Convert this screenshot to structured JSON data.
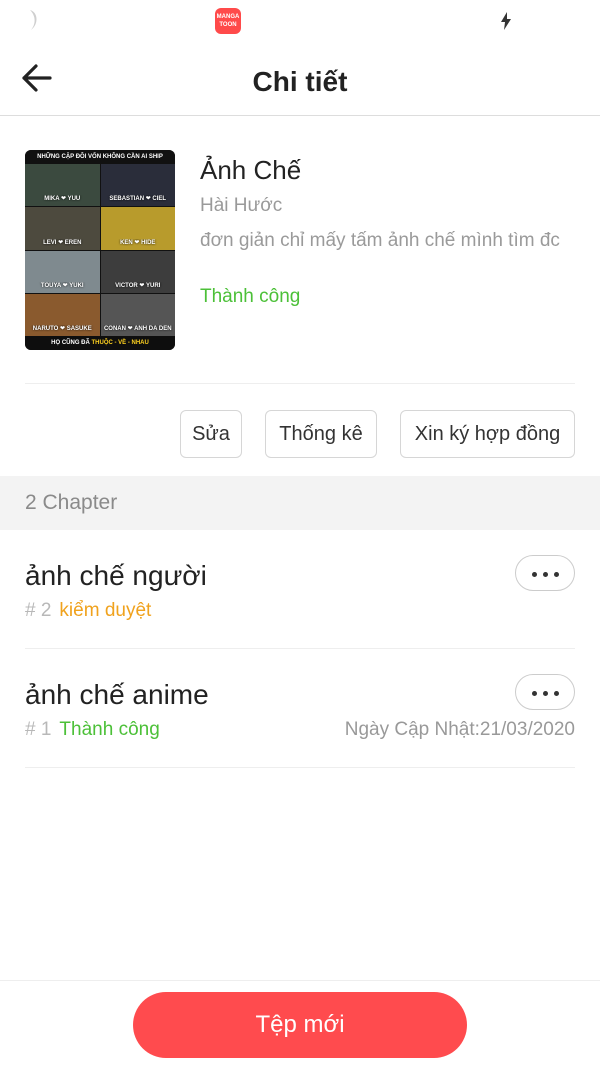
{
  "status_bar": {
    "app_badge": "MANGA TOON",
    "left_icon": "moon-icon",
    "right_icon": "bolt-icon"
  },
  "header": {
    "title": "Chi tiết",
    "back_icon": "arrow-left-icon"
  },
  "comic": {
    "title": "Ảnh Chế",
    "genre": "Hài Hước",
    "description": "đơn giản chỉ mấy tấm ảnh chế mình tìm đc",
    "status": "Thành công",
    "cover": {
      "top_text": "NHỮNG CẶP ĐÔI VỐN KHÔNG CẦN AI SHIP",
      "pairs": [
        "MIKA ❤ YUU",
        "SEBASTIAN ❤ CIEL",
        "LEVI ❤ EREN",
        "KEN ❤ HIDE",
        "TOUYA ❤ YUKI",
        "VICTOR ❤ YURI",
        "NARUTO ❤ SASUKE",
        "CONAN ❤ ANH DA DEN"
      ],
      "bottom_text_prefix": "HỌ CŨNG ĐÃ ",
      "bottom_text_highlight": "THUỘC - VỀ - NHAU"
    }
  },
  "actions": {
    "edit": "Sửa",
    "stats": "Thống kê",
    "contract": "Xin ký hợp đồng"
  },
  "chapters": {
    "count_label": "2 Chapter",
    "items": [
      {
        "title": "ảnh chế người",
        "number": "# 2",
        "status": "kiểm duyệt",
        "date": ""
      },
      {
        "title": "ảnh chế anime",
        "number": "# 1",
        "status": "Thành công",
        "date": "Ngày Cập Nhật:21/03/2020"
      }
    ]
  },
  "footer": {
    "new_button": "Tệp mới"
  },
  "colors": {
    "accent": "#ff4b4e",
    "success": "#4cc038",
    "pending": "#f0a21d"
  }
}
